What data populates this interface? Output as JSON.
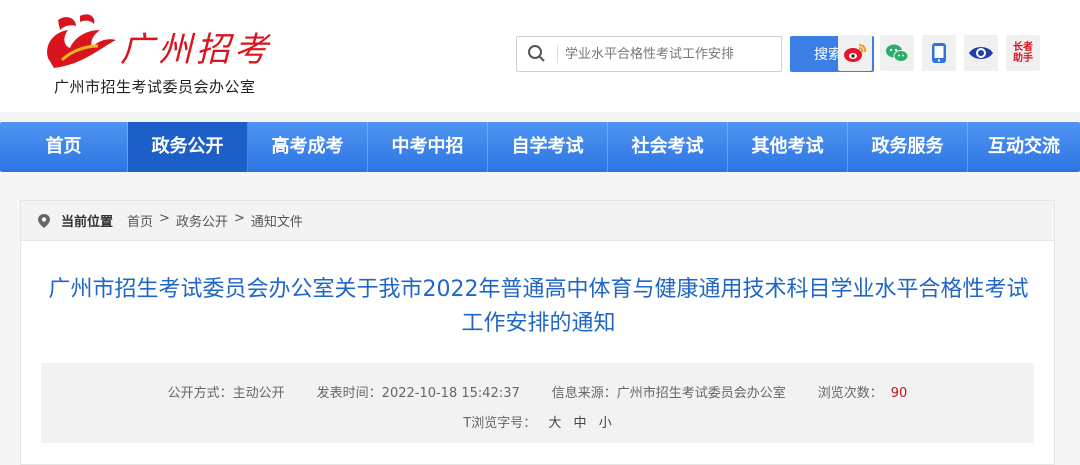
{
  "site": {
    "logo_text": "广州招考",
    "org_name": "广州市招生考试委员会办公室"
  },
  "search": {
    "placeholder": "学业水平合格性考试工作安排",
    "button_label": "搜索"
  },
  "share_icons": [
    "weibo-icon",
    "wechat-icon",
    "mobile-icon",
    "eye-icon",
    "elder-assist-icon"
  ],
  "elder_label_1": "长者",
  "elder_label_2": "助手",
  "nav": {
    "items": [
      "首页",
      "政务公开",
      "高考成考",
      "中考中招",
      "自学考试",
      "社会考试",
      "其他考试",
      "政务服务",
      "互动交流"
    ],
    "active_index": 1
  },
  "breadcrumb": {
    "label": "当前位置",
    "path": [
      "首页",
      ">",
      "政务公开",
      ">",
      "通知文件"
    ]
  },
  "article": {
    "title": "广州市招生考试委员会办公室关于我市2022年普通高中体育与健康通用技术科目学业水平合格性考试工作安排的通知",
    "disclosure": "公开方式：主动公开",
    "published": "发表时间：2022-10-18 15:42:37",
    "source": "信息来源：广州市招生考试委员会办公室",
    "views_label": "浏览次数：",
    "views": "90",
    "font_size_label": "T浏览字号：",
    "font_sizes": [
      "大",
      "中",
      "小"
    ]
  },
  "colors": {
    "brand_red": "#d9141c",
    "nav_blue": "#3a7fe6",
    "title_blue": "#1f66c7"
  }
}
